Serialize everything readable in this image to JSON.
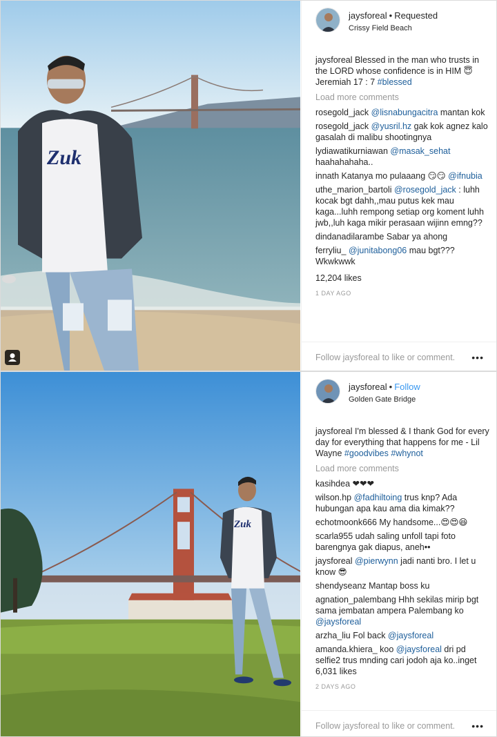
{
  "post1": {
    "username": "jaysforeal",
    "status": "Requested",
    "location": "Crissy Field Beach",
    "caption_user": "jaysforeal",
    "caption_text": " Blessed in the man who trusts in the LORD whose confidence is in HIM 😇 Jeremiah 17 : 7 ",
    "caption_tag": "#blessed",
    "load_more": "Load more comments",
    "comments": [
      {
        "user": "rosegold_jack",
        "mention": "@lisnabungacitra",
        "text": " mantan kok"
      },
      {
        "user": "rosegold_jack",
        "mention": "@yusril.hz",
        "text": " gak kok agnez kalo gasalah di malibu shootingnya"
      },
      {
        "user": "lydiawatikurniawan",
        "mention": "@masak_sehat",
        "text": " haahahahaha.."
      },
      {
        "user": "innath",
        "pre": " Katanya mo pulaaang 😏😏 ",
        "mention": "@ifnubia",
        "text": ""
      },
      {
        "user": "uthe_marion_bartoli",
        "mention": "@rosegold_jack",
        "text": " : luhh kocak bgt dahh,,mau putus kek mau kaga...luhh rempong setiap org koment luhh jwb,,luh kaga mikir perasaan wijinn emng??"
      },
      {
        "user": "dindanadilarambe",
        "pre": " Sabar ya ahong",
        "mention": "",
        "text": ""
      },
      {
        "user": "ferryliu_",
        "mention": "@junitabong06",
        "text": " mau bgt??? Wkwkwwk"
      }
    ],
    "likes": "12,204 likes",
    "time": "1 DAY AGO",
    "footer": "Follow jaysforeal to like or comment.",
    "more": "•••"
  },
  "post2": {
    "username": "jaysforeal",
    "status": "Follow",
    "location": "Golden Gate Bridge",
    "caption_user": "jaysforeal",
    "caption_text": " I'm blessed & I thank God for every day for everything that happens for me - Lil Wayne ",
    "caption_tag": "#goodvibes #whynot",
    "load_more": "Load more comments",
    "comments": [
      {
        "user": "kasihdea",
        "pre": " ❤❤❤",
        "mention": "",
        "text": ""
      },
      {
        "user": "wilson.hp",
        "mention": "@fadhiltoing",
        "text": " trus knp? Ada hubungan apa kau ama dia kimak??"
      },
      {
        "user": "echotmoonk666",
        "pre": " My handsome...😍😍😆",
        "mention": "",
        "text": ""
      },
      {
        "user": "scarla955",
        "pre": " udah saling unfoll tapi foto barengnya gak diapus, aneh••",
        "mention": "",
        "text": ""
      },
      {
        "user": "jaysforeal",
        "mention": "@pierwynn",
        "text": " jadi nanti bro. I let u know 😎"
      },
      {
        "user": "shendyseanz",
        "pre": " Mantap boss ku",
        "mention": "",
        "text": ""
      },
      {
        "user": "agnation_palembang",
        "pre": " Hhh sekilas mirip bgt sama jembatan ampera Palembang ko ",
        "mention": "@jaysforeal",
        "text": ""
      },
      {
        "user": "arzha_liu",
        "pre": " Fol back ",
        "mention": "@jaysforeal",
        "text": ""
      },
      {
        "user": "amanda.khiera_",
        "pre": " koo ",
        "mention": "@jaysforeal",
        "text": " dri pd selfie2 trus mnding cari jodoh aja ko..inget"
      }
    ],
    "likes": "6,031 likes",
    "time": "2 DAYS AGO",
    "footer": "Follow jaysforeal to like or comment.",
    "more": "•••"
  },
  "colors": {
    "link": "#1d5e9a",
    "follow": "#3897f0",
    "muted": "#999999"
  },
  "icons": {
    "usertag": "user-tag-icon",
    "more": "more-options-icon"
  }
}
